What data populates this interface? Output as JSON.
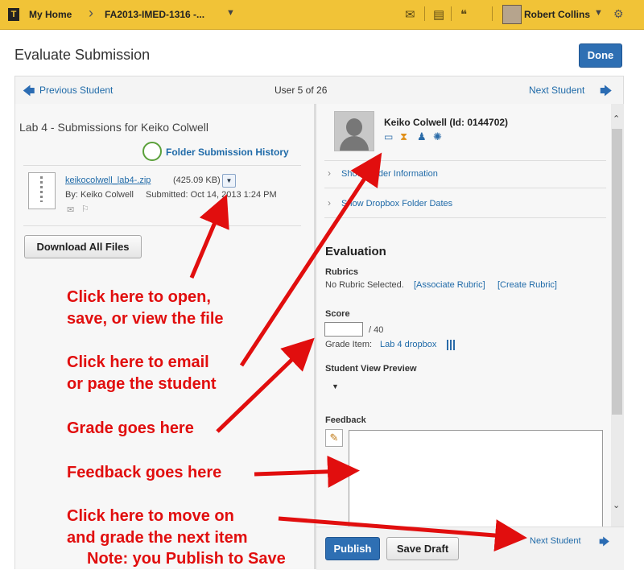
{
  "topnav": {
    "logo": "T",
    "home": "My Home",
    "course": "FA2013-IMED-1316 -...",
    "user": "Robert Collins"
  },
  "page": {
    "title": "Evaluate Submission",
    "done": "Done"
  },
  "pager": {
    "prev": "Previous Student",
    "position": "User 5 of 26",
    "next": "Next Student"
  },
  "left": {
    "heading": "Lab 4 - Submissions for Keiko Colwell",
    "history": "Folder Submission History",
    "file": {
      "name": "keikocolwell_lab4-.zip",
      "size": "(425.09 KB)",
      "by": "By: Keiko Colwell",
      "submitted": "Submitted: Oct 14, 2013 1:24 PM"
    },
    "download": "Download All Files"
  },
  "student": {
    "name": "Keiko Colwell (Id: 0144702)"
  },
  "sections": {
    "folder_info": "Show Folder Information",
    "folder_dates": "Show Dropbox Folder Dates"
  },
  "evaluation": {
    "heading": "Evaluation",
    "rubrics_label": "Rubrics",
    "rubrics_none": "No Rubric Selected.",
    "associate": "[Associate Rubric]",
    "create": "[Create Rubric]",
    "score_label": "Score",
    "score_value": "",
    "score_out_of": "/ 40",
    "grade_item_label": "Grade Item:",
    "grade_item": "Lab 4 dropbox",
    "preview_label": "Student View Preview",
    "feedback_label": "Feedback",
    "feedback_value": ""
  },
  "footer": {
    "publish": "Publish",
    "save_draft": "Save Draft",
    "next": "Next Student"
  },
  "annotations": {
    "open": [
      "Click here to open,",
      "save, or view the file"
    ],
    "email": [
      "Click here to email",
      "or page the student"
    ],
    "grade": "Grade goes here",
    "feedback": "Feedback goes here",
    "move": [
      "Click here to move on",
      "and grade the next item"
    ],
    "note": "Note: you Publish to Save"
  }
}
